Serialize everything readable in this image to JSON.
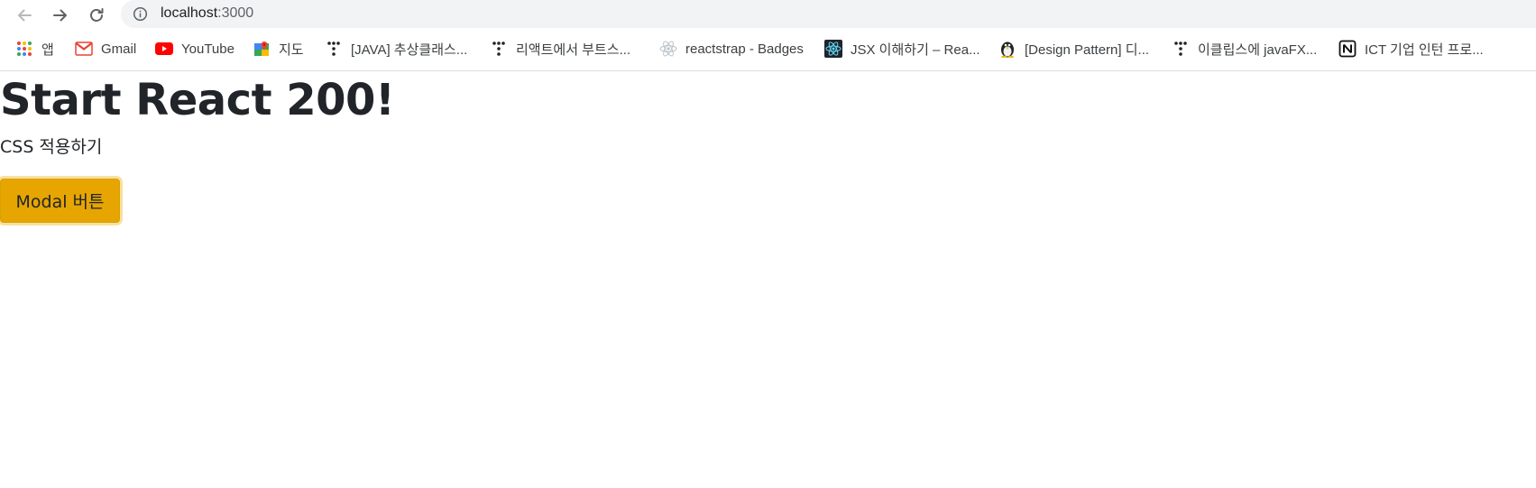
{
  "browser": {
    "url_host": "localhost",
    "url_port": ":3000",
    "bookmarks": [
      {
        "label": "앱",
        "icon": "apps-grid-icon"
      },
      {
        "label": "Gmail",
        "icon": "gmail-icon"
      },
      {
        "label": "YouTube",
        "icon": "youtube-icon"
      },
      {
        "label": "지도",
        "icon": "maps-icon"
      },
      {
        "label": "[JAVA] 추상클래스...",
        "icon": "tistory-icon"
      },
      {
        "label": "리액트에서 부트스...",
        "icon": "tistory-icon"
      },
      {
        "label": "reactstrap - Badges",
        "icon": "react-icon"
      },
      {
        "label": "JSX 이해하기 – Rea...",
        "icon": "react-dark-icon"
      },
      {
        "label": "[Design Pattern] 디...",
        "icon": "penguin-icon"
      },
      {
        "label": "이클립스에 javaFX...",
        "icon": "tistory-icon"
      },
      {
        "label": "ICT 기업 인턴 프로...",
        "icon": "notion-icon"
      }
    ]
  },
  "page": {
    "title": "Start React 200!",
    "subtitle": "CSS 적용하기",
    "button_label": "Modal 버튼"
  },
  "colors": {
    "button_bg": "#e6a500",
    "omnibox_bg": "#f1f3f4",
    "text": "#212529"
  }
}
